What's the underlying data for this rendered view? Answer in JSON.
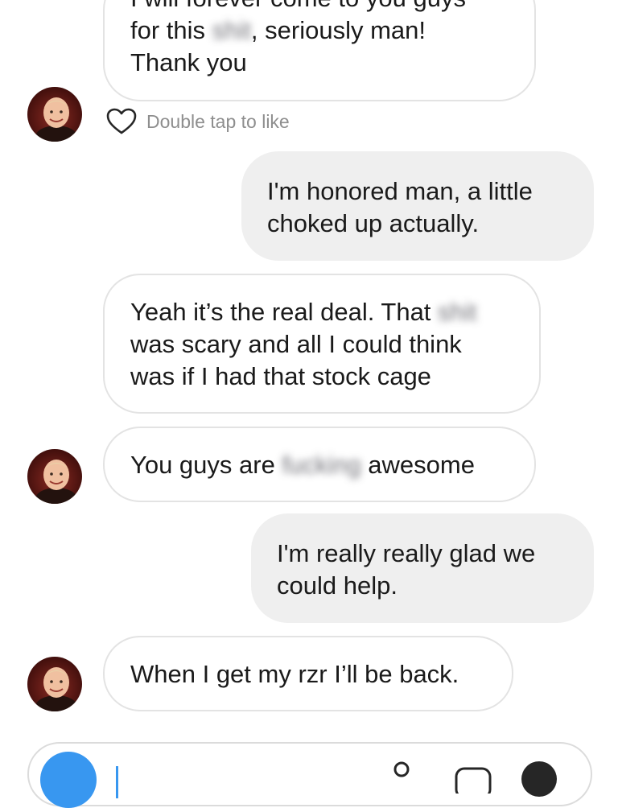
{
  "messages": [
    {
      "sender": "them",
      "lines": [
        [
          "I will forever come to you guys"
        ],
        [
          "for this ",
          {
            "blur": "shit"
          },
          ", seriously man!"
        ],
        [
          "Thank you"
        ]
      ]
    },
    {
      "like_hint": "Double tap to like"
    },
    {
      "sender": "me",
      "lines": [
        [
          "I'm honored man, a little"
        ],
        [
          "choked up actually."
        ]
      ]
    },
    {
      "sender": "them",
      "lines": [
        [
          "Yeah it’s the real deal. That ",
          {
            "blur": "shit"
          }
        ],
        [
          "was scary and all I could think"
        ],
        [
          "was if I had that stock cage"
        ]
      ]
    },
    {
      "sender": "them",
      "lines": [
        [
          "You guys are ",
          {
            "blur": "fucking"
          },
          " awesome"
        ]
      ]
    },
    {
      "sender": "me",
      "lines": [
        [
          "I'm really really glad we"
        ],
        [
          "could help."
        ]
      ]
    },
    {
      "sender": "them",
      "lines": [
        [
          "When I get my rzr I’ll be back."
        ]
      ]
    }
  ],
  "colors": {
    "incoming_border": "#e3e3e3",
    "outgoing_bg": "#efefef",
    "camera_blue": "#3897f0",
    "hint_gray": "#8e8e8e"
  },
  "icons": [
    "avatar",
    "heart-icon",
    "camera-icon",
    "person-icon",
    "sticker-icon",
    "more-icon"
  ]
}
